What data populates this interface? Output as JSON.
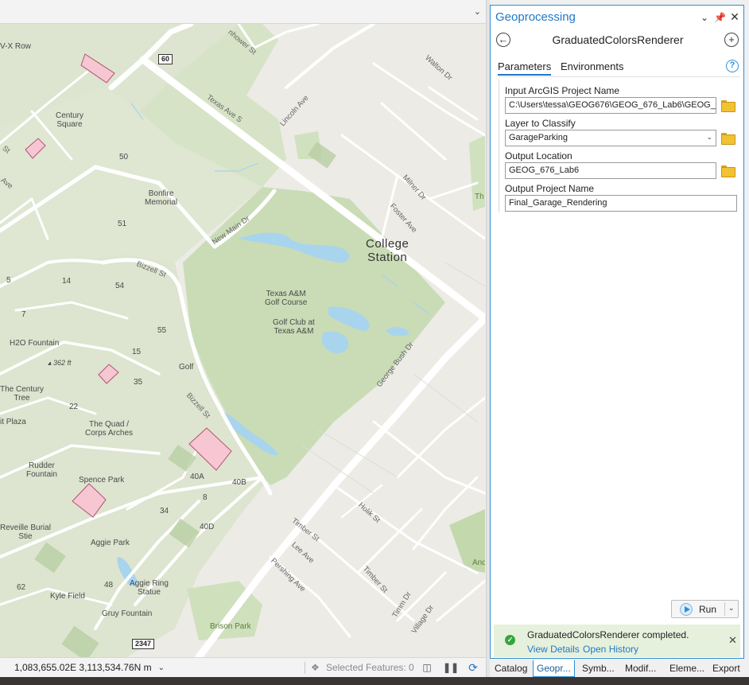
{
  "map": {
    "shields": [
      "60",
      "2347"
    ],
    "city": [
      "College",
      "Station"
    ],
    "labels": {
      "row": "V-X Row",
      "century_square": [
        "Century",
        "Square"
      ],
      "bonfire": [
        "Bonfire",
        "Memorial"
      ],
      "golf_course": [
        "Texas A&M",
        "Golf Course"
      ],
      "golf_club": [
        "Golf Club at",
        "Texas A&M"
      ],
      "h2o": "H2O Fountain",
      "elev": "362 ft",
      "golf": "Golf",
      "century_tree": [
        "The Century",
        "Tree"
      ],
      "plaza": "it Plaza",
      "quad": [
        "The Quad /",
        "Corps Arches"
      ],
      "rudder": [
        "Rudder",
        "Fountain"
      ],
      "spence": "Spence Park",
      "reveille": [
        "Reveille Burial",
        "Stie"
      ],
      "aggie_park": "Aggie Park",
      "aggie_ring": [
        "Aggie Ring",
        "Statue"
      ],
      "kyle": "Kyle Field",
      "gruy": "Gruy Fountain",
      "brison": "Brison Park",
      "th": "Th",
      "and": "And"
    },
    "numbers": [
      "50",
      "51",
      "5",
      "14",
      "54",
      "7",
      "55",
      "15",
      "35",
      "22",
      "40A",
      "40B",
      "8",
      "34",
      "40D",
      "62",
      "48"
    ],
    "streets": {
      "texas_ave": "Texas Ave S",
      "lincoln": "Lincoln Ave",
      "walton": "Walton Dr",
      "eisenhower": "nhower St",
      "milner": "Milner Dr",
      "foster": "Foster Ave",
      "new_main": "New Main Dr",
      "bizzell_1": "Bizzell St",
      "bizzell_2": "Bizzell St",
      "george_bush": "George Bush Dr",
      "holik": "Holik St",
      "timber_1": "Timber St",
      "timber_2": "Timber St",
      "lee": "Lee Ave",
      "pershing": "Pershing Ave",
      "timm": "Timm Dr",
      "village": "Village Dr",
      "st_left": "St",
      "ave_left": "Ave"
    }
  },
  "status_bar": {
    "coordinates": "1,083,655.02E 3,113,534.76N m",
    "selected_features": "Selected Features: 0"
  },
  "geoprocessing": {
    "title": "Geoprocessing",
    "tool_name": "GraduatedColorsRenderer",
    "tabs": [
      "Parameters",
      "Environments"
    ],
    "params": [
      {
        "label": "Input ArcGIS Project Name",
        "value": "C:\\Users\\tessa\\GEOG676\\GEOG_676_Lab6\\GEOG_"
      },
      {
        "label": "Layer to Classify",
        "value": "GarageParking"
      },
      {
        "label": "Output Location",
        "value": "GEOG_676_Lab6"
      },
      {
        "label": "Output Project Name",
        "value": "Final_Garage_Rendering"
      }
    ],
    "run_label": "Run",
    "message": "GraduatedColorsRenderer completed.",
    "view_details": "View Details",
    "open_history": "Open History"
  },
  "pane_tabs": [
    "Catalog",
    "Geopr...",
    "Symb...",
    "Modif...",
    "Eleme...",
    "Export"
  ],
  "colors": {
    "accent": "#1f78c8",
    "park_green": "#c9dcb6",
    "water": "#a8d4ee",
    "garage_pink": "#f7c6d3",
    "success_bg": "#e5f1dd"
  }
}
